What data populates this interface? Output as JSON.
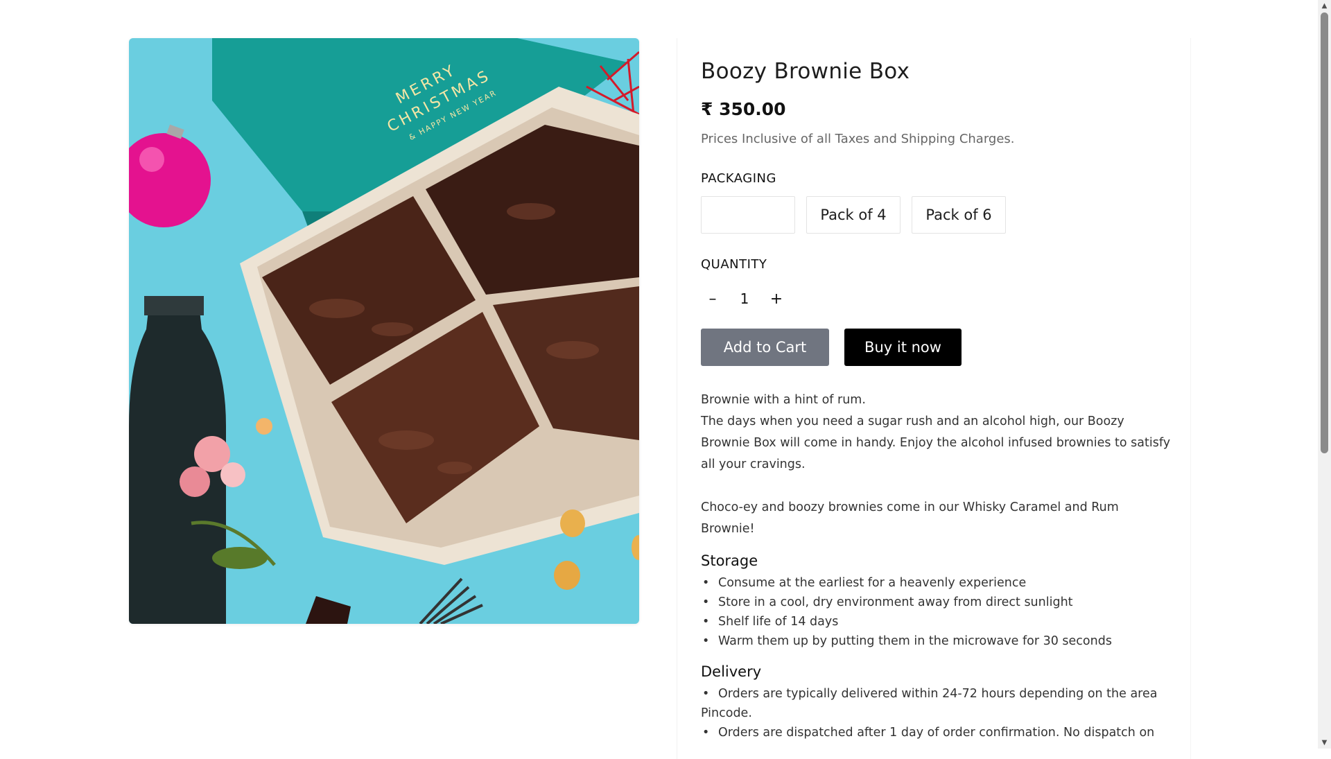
{
  "product": {
    "title": "Boozy Brownie Box",
    "price": "₹ 350.00",
    "tax_note": "Prices Inclusive of all Taxes and Shipping Charges.",
    "image_alt_text": "MERRY CHRISTMAS & HAPPY NEW YEAR"
  },
  "packaging": {
    "label": "PACKAGING",
    "options": [
      "",
      "Pack of 4",
      "Pack of 6"
    ]
  },
  "quantity": {
    "label": "QUANTITY",
    "minus": "–",
    "value": "1",
    "plus": "+"
  },
  "actions": {
    "add_to_cart": "Add to Cart",
    "buy_now": "Buy it now"
  },
  "description": {
    "line1": "Brownie with a hint of rum.",
    "line2": "The days when you need a sugar rush and an alcohol high, our Boozy Brownie Box will come in handy. Enjoy the alcohol infused brownies to satisfy all your cravings.",
    "line3": "Choco-ey and boozy brownies come in our Whisky Caramel and Rum Brownie!"
  },
  "storage": {
    "heading": "Storage",
    "items": [
      "Consume at the earliest for a heavenly experience",
      "Store in a cool, dry environment away from direct sunlight",
      "Shelf life of 14 days",
      "Warm them up by putting them in the microwave for 30 seconds"
    ]
  },
  "delivery": {
    "heading": "Delivery",
    "items": [
      "Orders are typically delivered within 24-72 hours depending on the area Pincode.",
      "Orders are dispatched after 1 day of order confirmation. No dispatch on"
    ]
  },
  "colors": {
    "background_teal": "#5ec9dc",
    "cart_button": "#707580",
    "buy_button": "#000000"
  },
  "scrollbar": {
    "up_icon": "triangle-up-icon",
    "down_icon": "triangle-down-icon"
  }
}
